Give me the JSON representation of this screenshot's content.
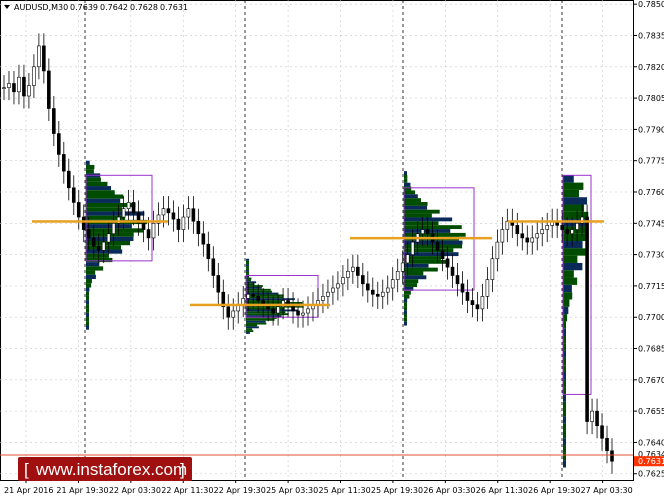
{
  "header": {
    "symbol": "AUDUSD,M30",
    "open": "0.7639",
    "high": "0.7642",
    "low": "0.7628",
    "close": "0.7631"
  },
  "price_axis": {
    "ticks": [
      "0.7850",
      "0.7835",
      "0.7820",
      "0.7805",
      "0.7790",
      "0.7775",
      "0.7760",
      "0.7745",
      "0.7730",
      "0.7715",
      "0.7700",
      "0.7685",
      "0.7670",
      "0.7655",
      "0.7640",
      "0.7625"
    ],
    "current_price": "0.7631",
    "marker_price": "0.7634"
  },
  "time_axis": {
    "ticks": [
      "21 Apr 2016",
      "21 Apr 19:30",
      "22 Apr 03:30",
      "22 Apr 11:30",
      "22 Apr 19:30",
      "25 Apr 03:30",
      "25 Apr 11:30",
      "25 Apr 19:30",
      "26 Apr 03:30",
      "26 Apr 11:30",
      "26 Apr 19:30",
      "27 Apr 03:30"
    ]
  },
  "watermark": {
    "text": "www.instaforex.com",
    "bracket_left": "[",
    "bracket_right": "]"
  },
  "colors": {
    "bull": "#000000",
    "bear": "#000000",
    "profile_green": "#004d00",
    "profile_navy": "#0a2a5a",
    "poc_line": "#e8a020",
    "value_area_box": "#9933cc",
    "day_separator": "#000000",
    "grid": "#c8c8c8",
    "price_line": "#e05030",
    "price_tag": "#ff3300",
    "watermark_bg": "#a01010"
  },
  "chart_data": {
    "type": "candlestick",
    "symbol": "AUDUSD",
    "timeframe": "M30",
    "ylim": [
      0.7622,
      0.7852
    ],
    "close_series": [
      0.781,
      0.7812,
      0.7808,
      0.7815,
      0.7806,
      0.7811,
      0.782,
      0.783,
      0.7818,
      0.78,
      0.7788,
      0.7778,
      0.777,
      0.7762,
      0.7755,
      0.7748,
      0.7742,
      0.7738,
      0.7734,
      0.7732,
      0.7736,
      0.774,
      0.7745,
      0.7748,
      0.7752,
      0.7755,
      0.775,
      0.7745,
      0.7742,
      0.7738,
      0.7745,
      0.7749,
      0.7752,
      0.775,
      0.7747,
      0.7742,
      0.7748,
      0.7752,
      0.7746,
      0.774,
      0.7735,
      0.7728,
      0.772,
      0.7712,
      0.7705,
      0.77,
      0.7703,
      0.7706,
      0.7709,
      0.7711,
      0.771,
      0.7708,
      0.7706,
      0.7704,
      0.7702,
      0.7705,
      0.7708,
      0.7706,
      0.7703,
      0.7701,
      0.7702,
      0.7704,
      0.7706,
      0.7708,
      0.771,
      0.7712,
      0.7714,
      0.7716,
      0.7719,
      0.7722,
      0.7724,
      0.772,
      0.7716,
      0.7713,
      0.7711,
      0.771,
      0.7712,
      0.7714,
      0.7718,
      0.7722,
      0.7726,
      0.773,
      0.7736,
      0.774,
      0.7742,
      0.774,
      0.7736,
      0.7732,
      0.7728,
      0.7724,
      0.772,
      0.7716,
      0.7712,
      0.7708,
      0.7706,
      0.7704,
      0.771,
      0.7718,
      0.7728,
      0.7736,
      0.7742,
      0.7746,
      0.7744,
      0.774,
      0.7738,
      0.7736,
      0.7738,
      0.774,
      0.7742,
      0.7744,
      0.7746,
      0.7744,
      0.7742,
      0.774,
      0.7742,
      0.7745,
      0.7748,
      0.765,
      0.7655,
      0.7648,
      0.7642,
      0.7636,
      0.7631
    ],
    "poc_levels": [
      0.7746,
      0.7706,
      0.7738,
      0.7746
    ],
    "value_areas": [
      {
        "top": 0.7768,
        "bottom": 0.7727
      },
      {
        "top": 0.772,
        "bottom": 0.77
      },
      {
        "top": 0.7762,
        "bottom": 0.7713
      },
      {
        "top": 0.7768,
        "bottom": 0.7663
      }
    ]
  }
}
